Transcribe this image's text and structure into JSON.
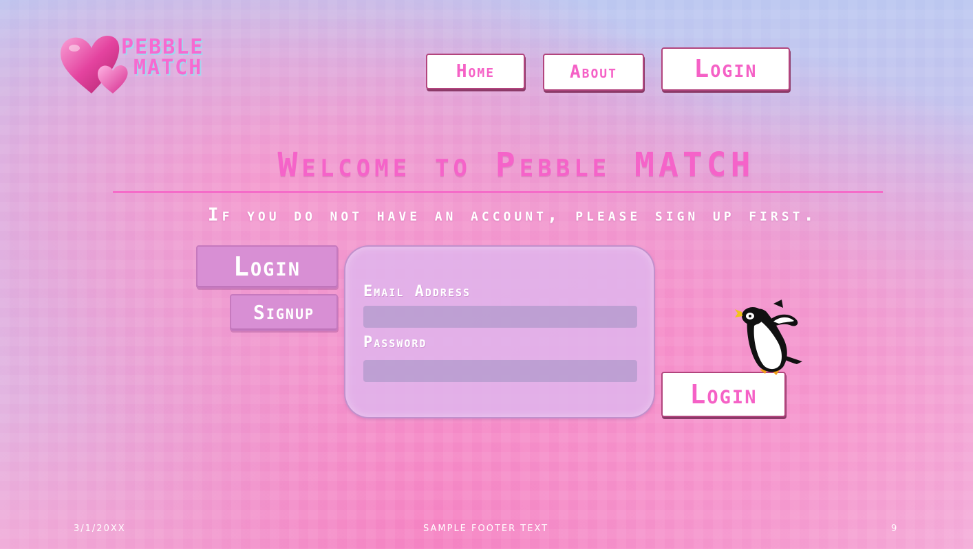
{
  "logo": {
    "line1": "PEBBLE",
    "line2": "MATCH",
    "icon": "hearts-icon"
  },
  "nav": {
    "home": "Home",
    "about": "About",
    "login": "Login"
  },
  "hero": {
    "title": "Welcome to Pebble MATCH",
    "subtitle": "If you do not have an account, please sign up first."
  },
  "tabs": {
    "login": "Login",
    "signup": "Signup"
  },
  "form": {
    "email_label": "Email Address",
    "email_value": "",
    "password_label": "Password",
    "password_value": "",
    "submit": "Login"
  },
  "mascot": {
    "icon": "penguin-icon"
  },
  "footer": {
    "date": "3/1/20XX",
    "text": "SAMPLE FOOTER TEXT",
    "page": "9"
  },
  "colors": {
    "accent_pink": "#f561c6",
    "button_border": "#b2447d",
    "tab_purple": "#d88fd4",
    "panel_lavender": "#e0b4ec"
  }
}
